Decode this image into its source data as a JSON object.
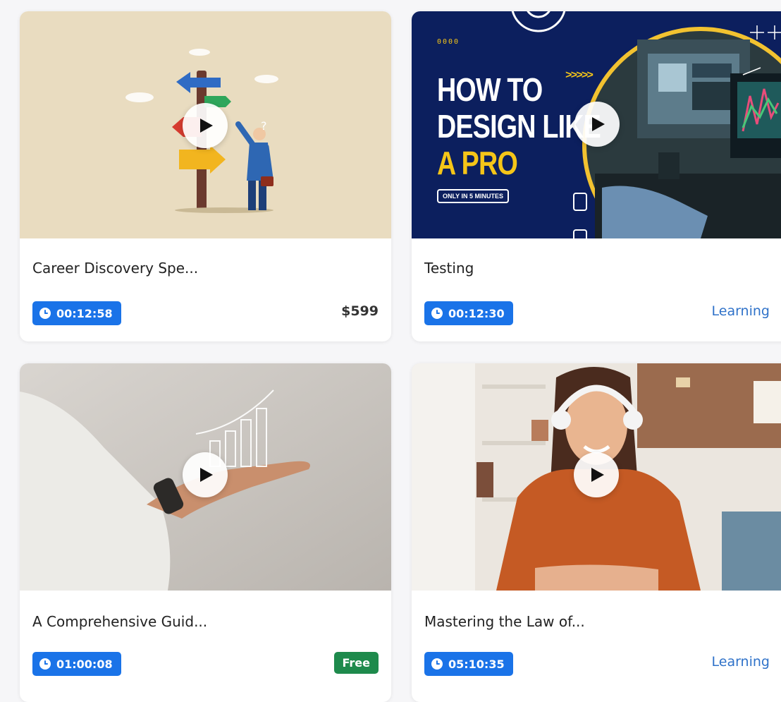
{
  "courses": [
    {
      "title": "Career Discovery Spe...",
      "duration": "00:12:58",
      "badge_type": "price",
      "badge": "$599",
      "thumbnail_icon": "signpost-illustration"
    },
    {
      "title": "Testing",
      "duration": "00:12:30",
      "badge_type": "status",
      "badge": "Learning",
      "thumbnail_icon": "design-promo-thumbnail",
      "thumbnail_text": {
        "dots": "0000",
        "line1": "HOW TO",
        "line2": "DESIGN LIKE",
        "line3": "A PRO",
        "tag": "ONLY IN 5 MINUTES",
        "arrows": ">>>>>"
      }
    },
    {
      "title": "A Comprehensive Guid...",
      "duration": "01:00:08",
      "badge_type": "free",
      "badge": "Free",
      "thumbnail_icon": "hand-with-growth-chart-photo"
    },
    {
      "title": "Mastering the Law of...",
      "duration": "05:10:35",
      "badge_type": "status",
      "badge": "Learning",
      "thumbnail_icon": "student-with-headphones-photo"
    }
  ],
  "colors": {
    "duration_badge": "#1a73e8",
    "free_badge": "#1e8a4c",
    "learning_text": "#2f72c9",
    "promo_bg": "#0c1f5e",
    "promo_accent": "#f5c518"
  }
}
